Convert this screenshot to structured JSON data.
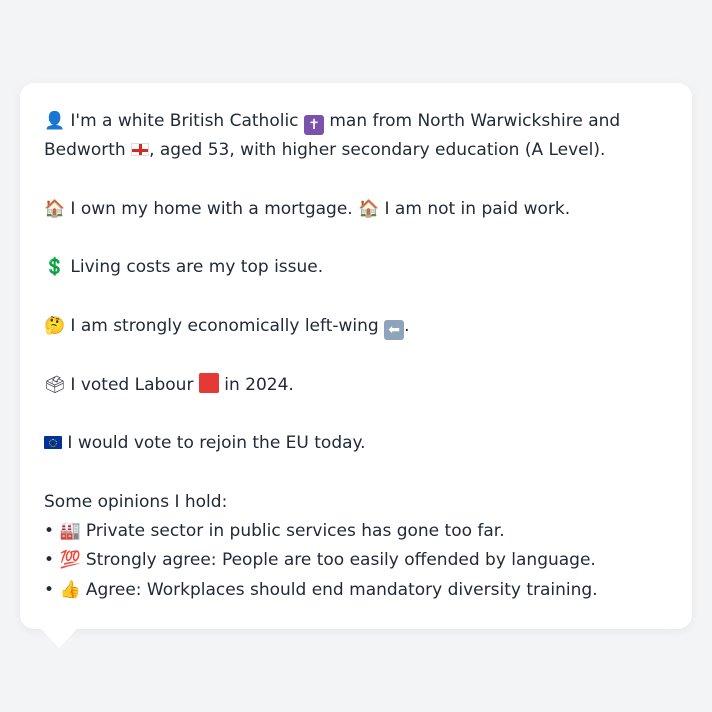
{
  "profile": {
    "intro": {
      "icon": "bust-in-silhouette-icon",
      "text_a": "I'm a white British Catholic",
      "text_b": "man from North Warwickshire and",
      "text_c": "Bedworth",
      "text_d": ", aged 53, with higher secondary education (A Level)."
    },
    "housing": {
      "icon": "house-icon",
      "text_a": "I own my home with a mortgage.",
      "text_b": "I am not in paid work."
    },
    "issue": {
      "icon": "dollar-sign-icon",
      "text": "Living costs are my top issue."
    },
    "economics": {
      "icon": "thinking-face-icon",
      "text": "I am strongly economically left-wing",
      "suffix": "."
    },
    "vote": {
      "icon": "ballot-box-icon",
      "text_a": "I voted Labour",
      "text_b": "in 2024.",
      "party_color": "#e53935"
    },
    "eu": {
      "icon": "eu-flag-icon",
      "text": "I would vote to rejoin the EU today."
    },
    "opinions": {
      "heading": "Some opinions I hold:",
      "bullet": "•",
      "items": [
        {
          "icon": "factory-icon",
          "glyph": "🏭",
          "text": "Private sector in public services has gone too far."
        },
        {
          "icon": "hundred-points-icon",
          "glyph": "💯",
          "text": "Strongly agree: People are too easily offended by language."
        },
        {
          "icon": "thumbs-up-icon",
          "glyph": "👍",
          "text": "Agree: Workplaces should end mandatory diversity training."
        }
      ]
    }
  },
  "glyphs": {
    "bust": "👤",
    "house": "🏠",
    "dollar": "💲",
    "thinking": "🤔",
    "ballot": "🗳",
    "cross": "✝",
    "left_arrow": "⬅"
  }
}
